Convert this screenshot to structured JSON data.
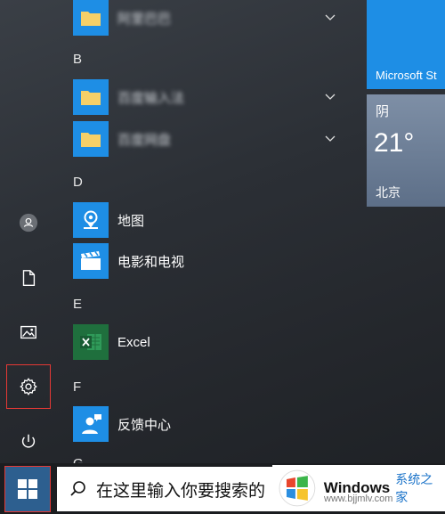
{
  "sections": [
    "B",
    "D",
    "E",
    "F",
    "G"
  ],
  "apps": {
    "folder_top": "阿里巴巴",
    "folder_b1": "百度输入法",
    "folder_b2": "百度网盘",
    "maps": "地图",
    "movies": "电影和电视",
    "excel": "Excel",
    "feedback": "反馈中心"
  },
  "tiles": {
    "store": "Microsoft St",
    "weather_condition": "阴",
    "weather_temp": "21°",
    "weather_city": "北京"
  },
  "search": {
    "text": "在这里输入你要搜索的"
  },
  "watermark": {
    "brand": "Windows",
    "site": "系统之家",
    "url": "www.bjjmlv.com"
  },
  "colors": {
    "accent": "#1e8ee5",
    "highlight": "#e53935",
    "excel": "#1f6f3d"
  }
}
